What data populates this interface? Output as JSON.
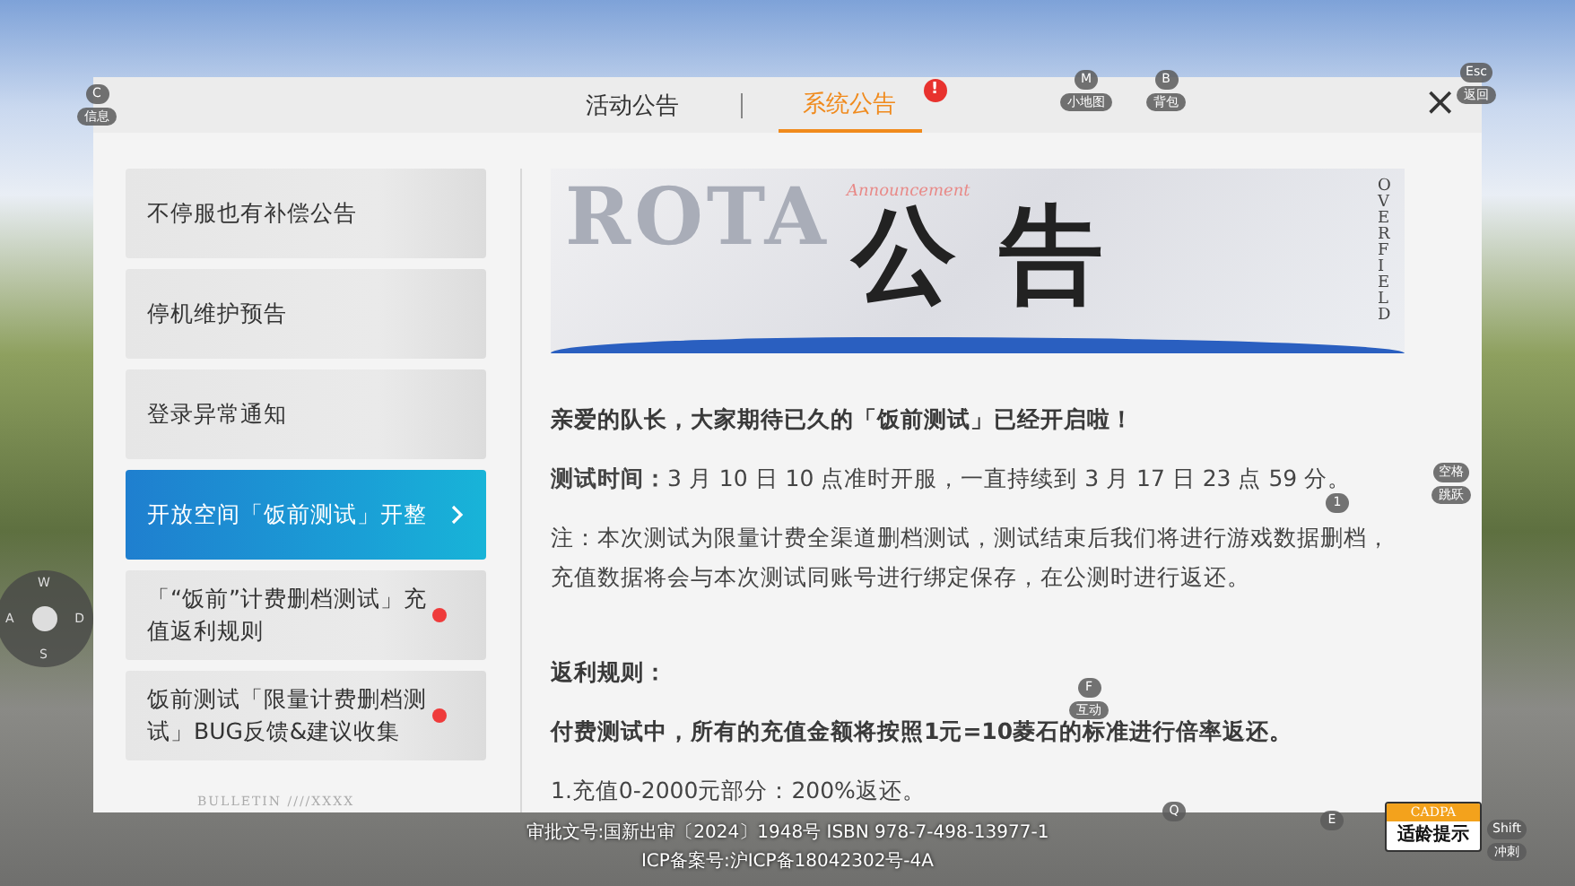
{
  "tabs": [
    {
      "label": "活动公告",
      "selected": false,
      "alert": false
    },
    {
      "label": "系统公告",
      "selected": true,
      "alert": true,
      "alert_text": "!"
    }
  ],
  "close": "×",
  "sidebar": {
    "items": [
      {
        "label": "不停服也有补偿公告",
        "selected": false,
        "unread": false
      },
      {
        "label": "停机维护预告",
        "selected": false,
        "unread": false
      },
      {
        "label": "登录异常通知",
        "selected": false,
        "unread": false
      },
      {
        "label": "开放空间「饭前测试」开整",
        "selected": true,
        "unread": false
      },
      {
        "label": "「“饭前”计费删档测试」充值返利规则",
        "selected": false,
        "unread": true
      },
      {
        "label": "饭前测试「限量计费删档测试」BUG反馈&建议收集",
        "selected": false,
        "unread": true
      }
    ]
  },
  "banner": {
    "title": "公告",
    "backdrop_text": "ROTA",
    "side_text": "OVERFIELD",
    "script_text": "Announcement"
  },
  "article": [
    {
      "kind": "bold",
      "text": "亲爱的队长，大家期待已久的「饭前测试」已经开启啦！"
    },
    {
      "kind": "mixed",
      "text": "**测试时间：**3 月 10 日 10 点准时开服，一直持续到 3 月 17 日 23 点 59 分。"
    },
    {
      "kind": "plain",
      "text": "注：本次测试为限量计费全渠道删档测试，测试结束后我们将进行游戏数据删档，充值数据将会与本次测试同账号进行绑定保存，在公测时进行返还。"
    },
    {
      "kind": "gap"
    },
    {
      "kind": "bold",
      "text": "返利规则："
    },
    {
      "kind": "bold",
      "text": "付费测试中，所有的充值金额将按照1元=10菱石的标准进行倍率返还。"
    },
    {
      "kind": "plain",
      "text": "1.充值0-2000元部分：200%返还。"
    }
  ],
  "panel_footer": "BULLETIN ////XXXX",
  "hud": [
    {
      "key": "C",
      "label": "信息"
    },
    {
      "key": "M",
      "label": "小地图"
    },
    {
      "key": "B",
      "label": "背包"
    },
    {
      "key": "Esc",
      "label": "返回"
    },
    {
      "key": "1"
    },
    {
      "key": "空格",
      "label": "跳跃"
    },
    {
      "key": "F",
      "label": "互动"
    },
    {
      "key": "Q"
    },
    {
      "key": "E"
    },
    {
      "key": "Shift",
      "label": "冲刺"
    }
  ],
  "joystick": {
    "keys": [
      "W",
      "A",
      "S",
      "D"
    ]
  },
  "legal": [
    "审批文号:国新出审〔2024〕1948号  ISBN 978-7-498-13977-1",
    "ICP备案号:沪ICP备18042302号-4A"
  ],
  "age_rating": {
    "top": "CADPA",
    "bottom": "适龄提示"
  }
}
